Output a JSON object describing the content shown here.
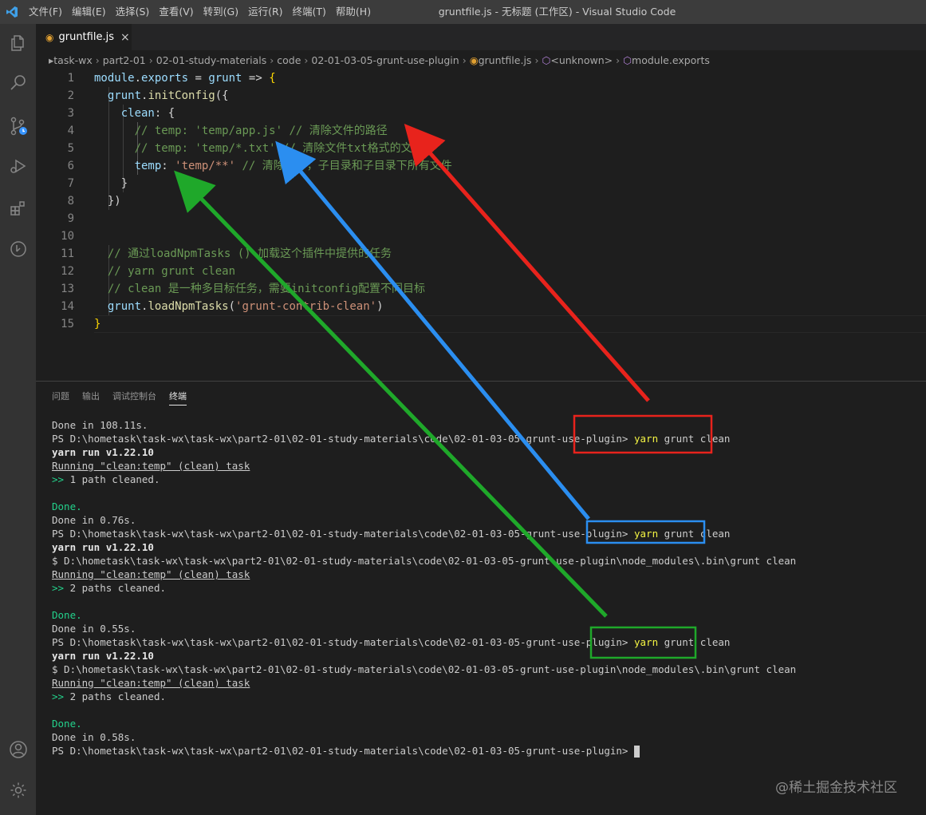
{
  "window": {
    "menu": [
      "文件(F)",
      "编辑(E)",
      "选择(S)",
      "查看(V)",
      "转到(G)",
      "运行(R)",
      "终端(T)",
      "帮助(H)"
    ],
    "title": "gruntfile.js - 无标题 (工作区) - Visual Studio Code"
  },
  "tab": {
    "label": "gruntfile.js",
    "close": "×"
  },
  "breadcrumb": [
    "task-wx",
    "part2-01",
    "02-01-study-materials",
    "code",
    "02-01-03-05-grunt-use-plugin",
    "gruntfile.js",
    "<unknown>",
    "module.exports"
  ],
  "editor": {
    "lines": [
      {
        "n": "1",
        "parts": [
          [
            "kw",
            "module"
          ],
          [
            "pl",
            "."
          ],
          [
            "kw",
            "exports"
          ],
          [
            "pl",
            " = "
          ],
          [
            "kw",
            "grunt"
          ],
          [
            "pl",
            " => "
          ],
          [
            "br1",
            "{"
          ]
        ]
      },
      {
        "n": "2",
        "parts": [
          [
            "pl",
            "  "
          ],
          [
            "kw",
            "grunt"
          ],
          [
            "pl",
            "."
          ],
          [
            "fn",
            "initConfig"
          ],
          [
            "pl",
            "({"
          ]
        ]
      },
      {
        "n": "3",
        "parts": [
          [
            "pl",
            "    "
          ],
          [
            "kw",
            "clean"
          ],
          [
            "pl",
            ": {"
          ]
        ]
      },
      {
        "n": "4",
        "parts": [
          [
            "pl",
            "      "
          ],
          [
            "cm",
            "// temp: 'temp/app.js' // 清除文件的路径"
          ]
        ]
      },
      {
        "n": "5",
        "parts": [
          [
            "pl",
            "      "
          ],
          [
            "cm",
            "// temp: 'temp/*.txt' // 清除文件txt格式的文件"
          ]
        ]
      },
      {
        "n": "6",
        "parts": [
          [
            "pl",
            "      "
          ],
          [
            "kw",
            "temp"
          ],
          [
            "pl",
            ": "
          ],
          [
            "str",
            "'temp/**'"
          ],
          [
            "pl",
            " "
          ],
          [
            "cm",
            "// 清除文件，子目录和子目录下所有文件"
          ]
        ]
      },
      {
        "n": "7",
        "parts": [
          [
            "pl",
            "    }"
          ]
        ]
      },
      {
        "n": "8",
        "parts": [
          [
            "pl",
            "  })"
          ]
        ]
      },
      {
        "n": "9",
        "parts": []
      },
      {
        "n": "10",
        "parts": []
      },
      {
        "n": "11",
        "parts": [
          [
            "pl",
            "  "
          ],
          [
            "cm",
            "// 通过loadNpmTasks () 加载这个插件中提供的任务"
          ]
        ]
      },
      {
        "n": "12",
        "parts": [
          [
            "pl",
            "  "
          ],
          [
            "cm",
            "// yarn grunt clean"
          ]
        ]
      },
      {
        "n": "13",
        "parts": [
          [
            "pl",
            "  "
          ],
          [
            "cm",
            "// clean 是一种多目标任务，需要initconfig配置不同目标"
          ]
        ]
      },
      {
        "n": "14",
        "parts": [
          [
            "pl",
            "  "
          ],
          [
            "kw",
            "grunt"
          ],
          [
            "pl",
            "."
          ],
          [
            "fn",
            "loadNpmTasks"
          ],
          [
            "pl",
            "("
          ],
          [
            "str",
            "'grunt-contrib-clean'"
          ],
          [
            "pl",
            ")"
          ]
        ]
      },
      {
        "n": "15",
        "parts": [
          [
            "br1",
            "}"
          ]
        ]
      }
    ]
  },
  "panel": {
    "tabs": [
      "问题",
      "输出",
      "调试控制台",
      "终端"
    ],
    "active_tab": "终端"
  },
  "terminal": {
    "lines": [
      [
        [
          "n",
          "Done in 108.11s."
        ]
      ],
      [
        [
          "n",
          "PS D:\\hometask\\task-wx\\task-wx\\part2-01\\02-01-study-materials\\code\\02-01-03-05-grunt-use-plugin> "
        ],
        [
          "yellow",
          "yarn"
        ],
        [
          "n",
          " grunt clean"
        ]
      ],
      [
        [
          "bold",
          "yarn run v1.22.10"
        ]
      ],
      [
        [
          "ul",
          "Running \"clean:temp\" (clean) task"
        ]
      ],
      [
        [
          "green",
          ">>"
        ],
        [
          "n",
          " 1 path cleaned."
        ]
      ],
      [],
      [
        [
          "green",
          "Done."
        ]
      ],
      [
        [
          "n",
          "Done in 0.76s."
        ]
      ],
      [
        [
          "n",
          "PS D:\\hometask\\task-wx\\task-wx\\part2-01\\02-01-study-materials\\code\\02-01-03-05-grunt-use-plugin> "
        ],
        [
          "yellow",
          "yarn"
        ],
        [
          "n",
          " grunt clean"
        ]
      ],
      [
        [
          "bold",
          "yarn run v1.22.10"
        ]
      ],
      [
        [
          "n",
          "$ D:\\hometask\\task-wx\\task-wx\\part2-01\\02-01-study-materials\\code\\02-01-03-05-grunt-use-plugin\\node_modules\\.bin\\grunt clean"
        ]
      ],
      [
        [
          "ul",
          "Running \"clean:temp\" (clean) task"
        ]
      ],
      [
        [
          "green",
          ">>"
        ],
        [
          "n",
          " 2 paths cleaned."
        ]
      ],
      [],
      [
        [
          "green",
          "Done."
        ]
      ],
      [
        [
          "n",
          "Done in 0.55s."
        ]
      ],
      [
        [
          "n",
          "PS D:\\hometask\\task-wx\\task-wx\\part2-01\\02-01-study-materials\\code\\02-01-03-05-grunt-use-plugin> "
        ],
        [
          "yellow",
          "yarn"
        ],
        [
          "n",
          " grunt clean"
        ]
      ],
      [
        [
          "bold",
          "yarn run v1.22.10"
        ]
      ],
      [
        [
          "n",
          "$ D:\\hometask\\task-wx\\task-wx\\part2-01\\02-01-study-materials\\code\\02-01-03-05-grunt-use-plugin\\node_modules\\.bin\\grunt clean"
        ]
      ],
      [
        [
          "ul",
          "Running \"clean:temp\" (clean) task"
        ]
      ],
      [
        [
          "green",
          ">>"
        ],
        [
          "n",
          " 2 paths cleaned."
        ]
      ],
      [],
      [
        [
          "green",
          "Done."
        ]
      ],
      [
        [
          "n",
          "Done in 0.58s."
        ]
      ],
      [
        [
          "n",
          "PS D:\\hometask\\task-wx\\task-wx\\part2-01\\02-01-study-materials\\code\\02-01-03-05-grunt-use-plugin> "
        ],
        [
          "cursor",
          ""
        ]
      ]
    ]
  },
  "watermark": "@稀土掘金技术社区",
  "annotation_colors": {
    "red": "#e8231c",
    "blue": "#2b8ef0",
    "green": "#1fa82a"
  }
}
